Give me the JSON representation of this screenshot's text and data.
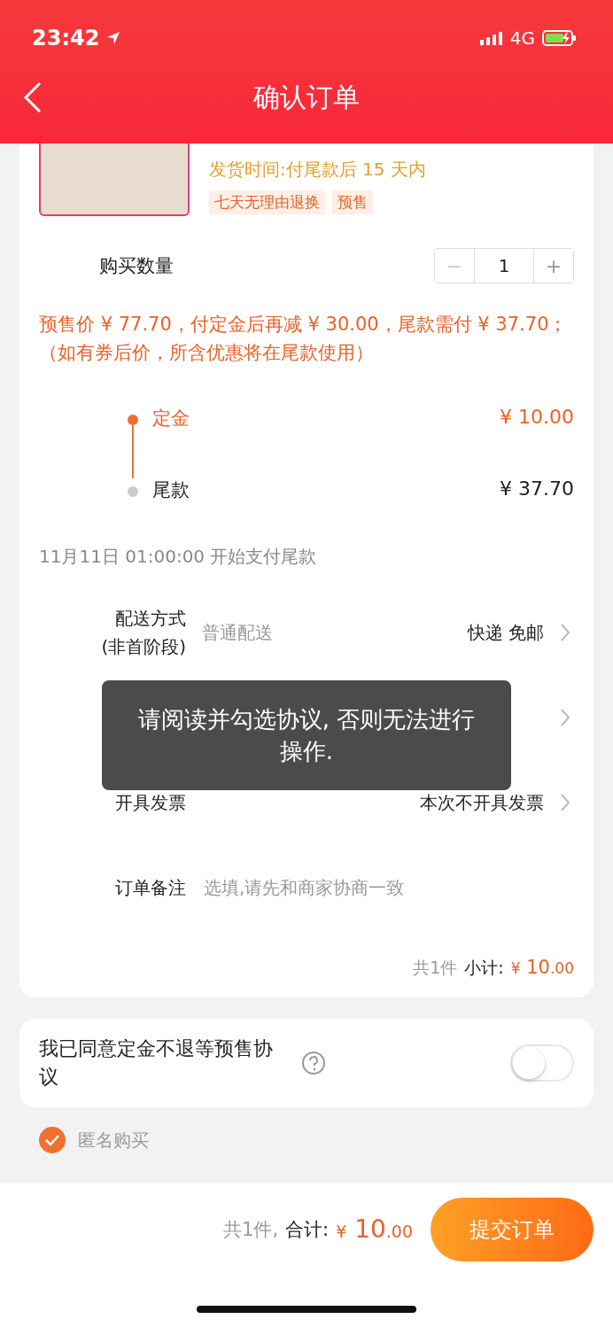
{
  "status_bar": {
    "time": "23:42",
    "network": "4G"
  },
  "nav": {
    "title": "确认订单"
  },
  "product": {
    "ship_time": "发货时间:付尾款后 15 天内",
    "tags": [
      "七天无理由退换",
      "预售"
    ]
  },
  "quantity": {
    "label": "购买数量",
    "value": "1",
    "minus": "−",
    "plus": "+"
  },
  "notice": {
    "text": "预售价 ¥ 77.70，付定金后再减 ¥ 30.00，尾款需付 ¥ 37.70；（如有券后价，所含优惠将在尾款使用）"
  },
  "stages": [
    {
      "label": "定金",
      "amount": "¥ 10.00",
      "selected": true
    },
    {
      "label": "尾款",
      "amount": "¥ 37.70",
      "selected": false
    }
  ],
  "due_note": "11月11日 01:00:00 开始支付尾款",
  "rows": [
    {
      "kind": "option",
      "label": "配送方式\n(非首阶段)",
      "value": "普通配送",
      "detail": "快递 免邮"
    },
    {
      "kind": "covered"
    },
    {
      "kind": "option",
      "label": "开具发票",
      "detail": "本次不开具发票"
    },
    {
      "kind": "input",
      "label": "订单备注",
      "placeholder": "选填,请先和商家协商一致"
    }
  ],
  "summary": {
    "count": "共1件",
    "label": "小计:",
    "currency": "¥",
    "amount": "10.00"
  },
  "agreement": {
    "text": "我已同意定金不退等预售协议",
    "on": false
  },
  "anonymous": {
    "label": "匿名购买",
    "checked": true
  },
  "footer": {
    "count": "共1件,",
    "label": "合计:",
    "currency": "¥",
    "amount": "10.00",
    "button": "提交订单"
  },
  "toast": {
    "text": "请阅读并勾选协议, 否则无法进行操作."
  }
}
